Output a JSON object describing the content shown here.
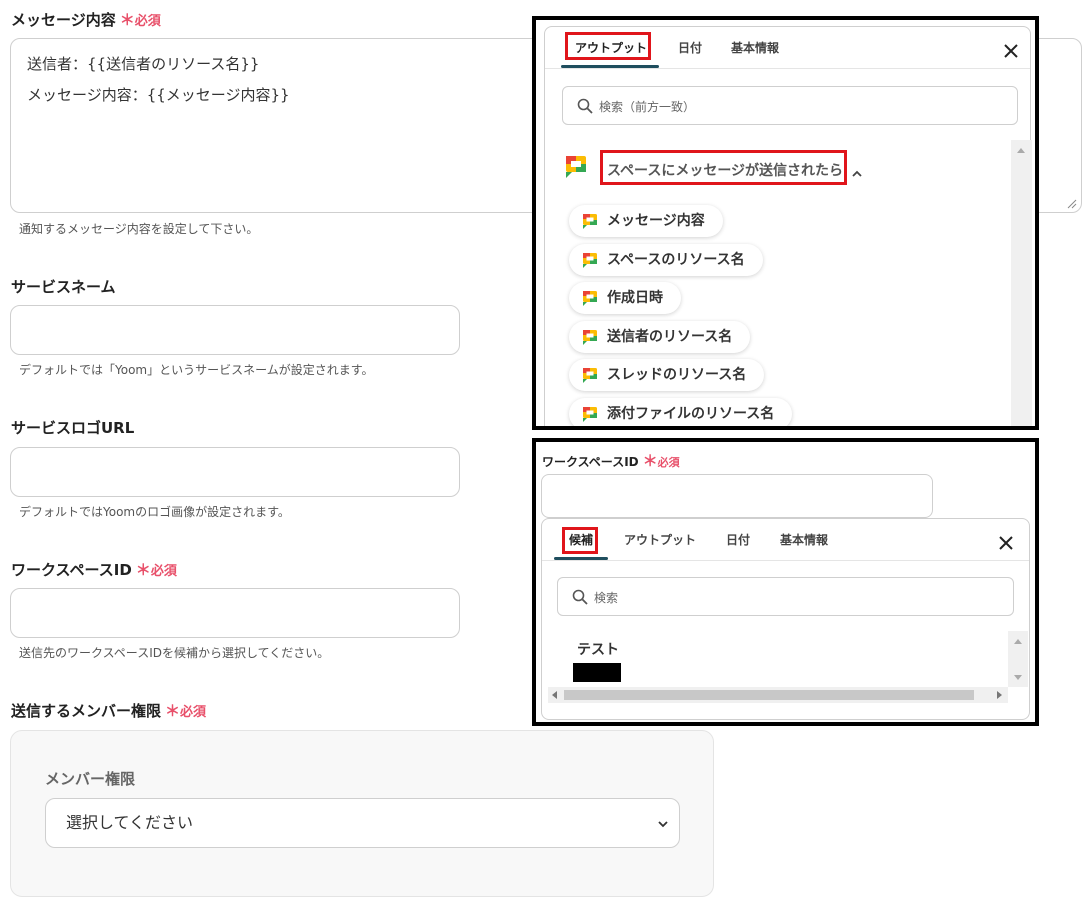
{
  "required_mark": "必須",
  "message_field": {
    "label": "メッセージ内容",
    "lines": [
      "送信者：{{送信者のリソース名}}",
      "メッセージ内容：{{メッセージ内容}}"
    ],
    "hint": "通知するメッセージ内容を設定して下さい。"
  },
  "service_name_field": {
    "label": "サービスネーム",
    "hint": "デフォルトでは「Yoom」というサービスネームが設定されます。"
  },
  "service_logo_field": {
    "label": "サービスロゴURL",
    "hint": "デフォルトではYoomのロゴ画像が設定されます。"
  },
  "workspace_field": {
    "label": "ワークスペースID",
    "hint": "送信先のワークスペースIDを候補から選択してください。"
  },
  "member_permission_field": {
    "label": "送信するメンバー権限",
    "inner_label": "メンバー権限",
    "select_value": "選択してください"
  },
  "output_panel": {
    "tabs": [
      "アウトプット",
      "日付",
      "基本情報"
    ],
    "search_placeholder": "検索（前方一致）",
    "section_title": "スペースにメッセージが送信されたら",
    "items": [
      "メッセージ内容",
      "スペースのリソース名",
      "作成日時",
      "送信者のリソース名",
      "スレッドのリソース名",
      "添付ファイルのリソース名"
    ]
  },
  "candidate_panel": {
    "field_label": "ワークスペースID",
    "tabs": [
      "候補",
      "アウトプット",
      "日付",
      "基本情報"
    ],
    "search_placeholder": "検索",
    "results": [
      "テスト"
    ]
  },
  "colors": {
    "required": "#e8506a",
    "highlight": "#e0151b",
    "tab_underline": "#1f4e5e"
  },
  "icons": {
    "close": "close-icon",
    "search": "search-icon",
    "chat": "google-chat-icon",
    "chevron": "chevron-down-icon"
  }
}
